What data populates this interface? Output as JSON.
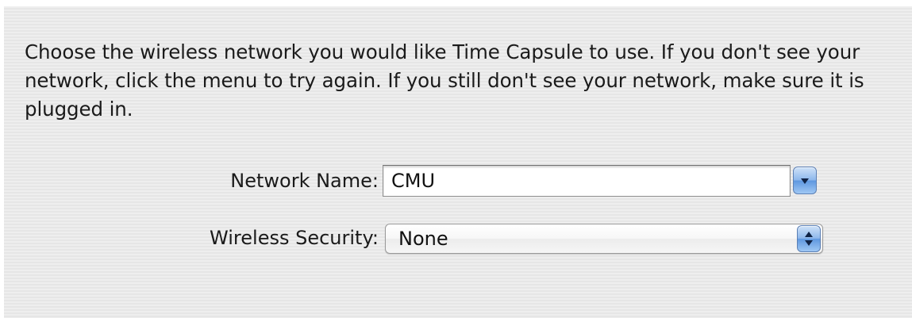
{
  "instructions": "Choose the wireless network you would like Time Capsule to use. If you don't see your network, click the menu to try again. If you still don't see your network, make sure it is plugged in.",
  "network_name": {
    "label": "Network Name:",
    "value": "CMU",
    "icon": "chevron-down-icon"
  },
  "wireless_security": {
    "label": "Wireless Security:",
    "selected": "None",
    "icon": "up-down-arrows-icon"
  },
  "colors": {
    "panel_background": "#ececec",
    "aqua_button": "#6fa5e6"
  }
}
